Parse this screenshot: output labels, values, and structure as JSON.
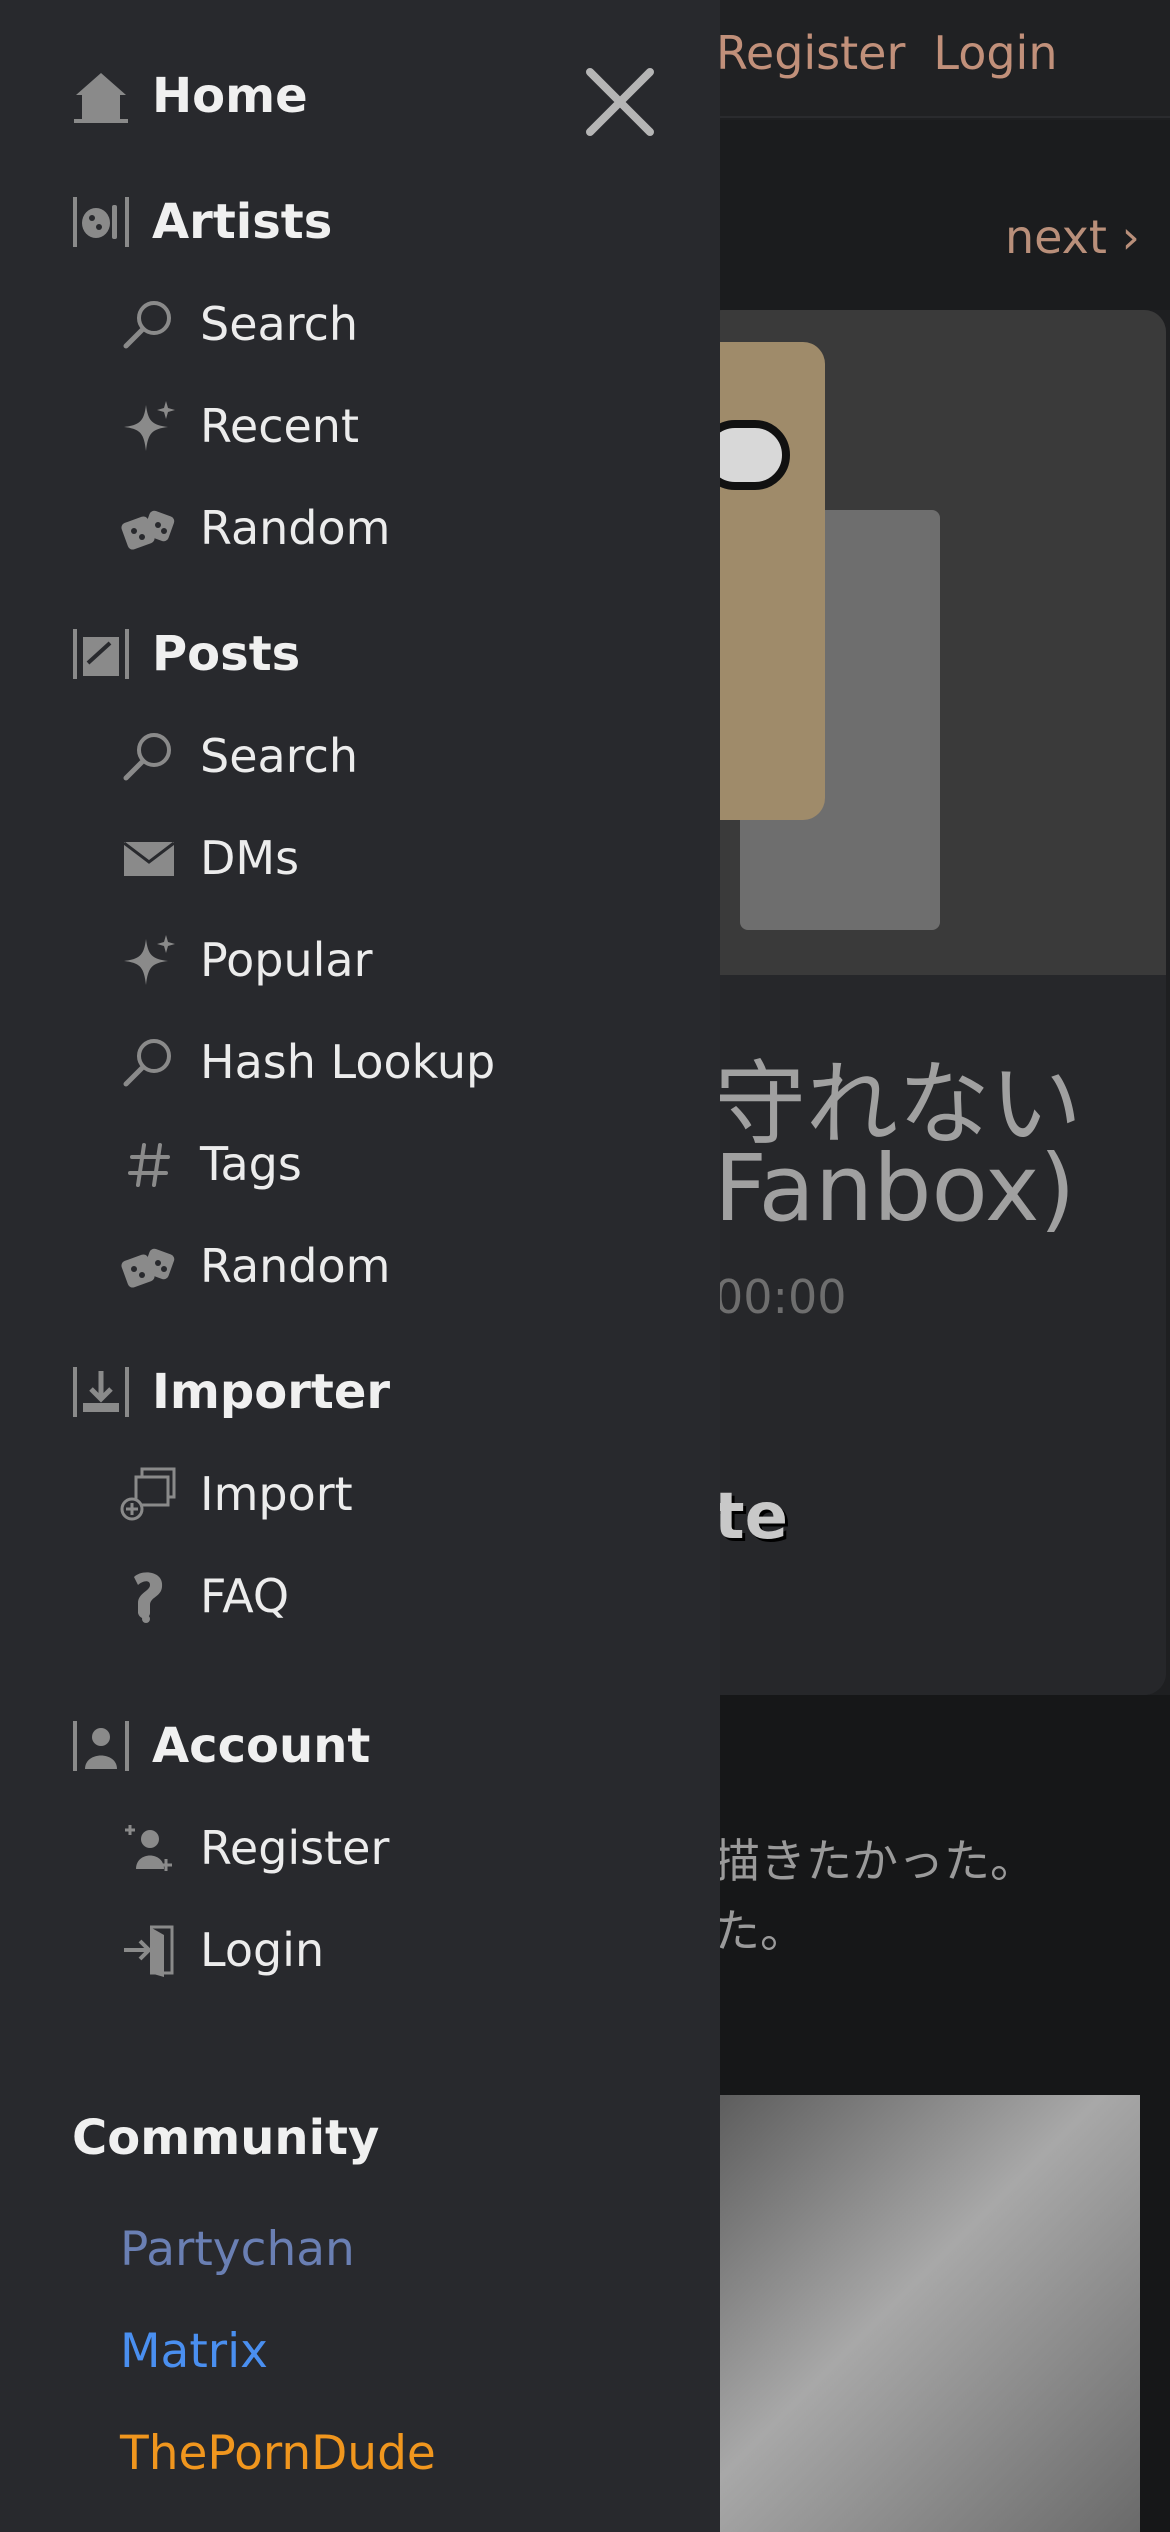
{
  "background": {
    "register_label": "Register",
    "login_label": "Login",
    "next_label": "next ›",
    "title_line1": "守れない",
    "title_line2": "Fanbox)",
    "date_fragment": "00:00",
    "subtitle_fragment": "te",
    "body_line1": "描きたかった。",
    "body_line2": "た。"
  },
  "sidebar": {
    "home": "Home",
    "artists": {
      "label": "Artists",
      "items": [
        "Search",
        "Recent",
        "Random"
      ]
    },
    "posts": {
      "label": "Posts",
      "items": [
        "Search",
        "DMs",
        "Popular",
        "Hash Lookup",
        "Tags",
        "Random"
      ]
    },
    "importer": {
      "label": "Importer",
      "items": [
        "Import",
        "FAQ"
      ]
    },
    "account": {
      "label": "Account",
      "items": [
        "Register",
        "Login"
      ]
    },
    "community": {
      "label": "Community",
      "links": [
        "Partychan",
        "Matrix",
        "ThePornDude"
      ]
    }
  },
  "colors": {
    "sidebar_bg": "#28292d",
    "icon_gray": "#8a8a8a",
    "partychan": "#6a7fb3",
    "matrix": "#4a8ff0",
    "theporndude": "#f0961e",
    "top_link": "#c1907a"
  }
}
